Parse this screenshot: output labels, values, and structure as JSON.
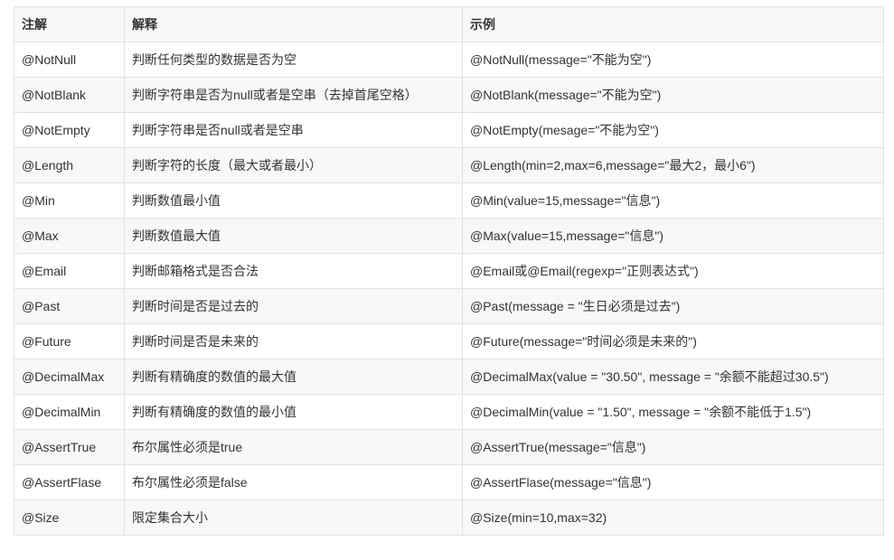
{
  "table": {
    "headers": [
      "注解",
      "解释",
      "示例"
    ],
    "rows": [
      [
        "@NotNull",
        "判断任何类型的数据是否为空",
        "@NotNull(message=\"不能为空\")"
      ],
      [
        "@NotBlank",
        "判断字符串是否为null或者是空串（去掉首尾空格）",
        "@NotBlank(message=\"不能为空\")"
      ],
      [
        "@NotEmpty",
        "判断字符串是否null或者是空串",
        "@NotEmpty(mesage=\"不能为空\")"
      ],
      [
        "@Length",
        "判断字符的长度（最大或者最小）",
        "@Length(min=2,max=6,message=\"最大2，最小6\")"
      ],
      [
        "@Min",
        "判断数值最小值",
        "@Min(value=15,message=\"信息\")"
      ],
      [
        "@Max",
        "判断数值最大值",
        "@Max(value=15,message=\"信息\")"
      ],
      [
        "@Email",
        "判断邮箱格式是否合法",
        "@Email或@Email(regexp=\"正则表达式\")"
      ],
      [
        "@Past",
        "判断时间是否是过去的",
        "@Past(message = \"生日必须是过去\")"
      ],
      [
        "@Future",
        "判断时间是否是未来的",
        "@Future(message=\"时间必须是未来的\")"
      ],
      [
        "@DecimalMax",
        "判断有精确度的数值的最大值",
        "@DecimalMax(value = \"30.50\", message = \"余额不能超过30.5\")"
      ],
      [
        "@DecimalMin",
        "判断有精确度的数值的最小值",
        "@DecimalMin(value = \"1.50\", message = \"余额不能低于1.5\")"
      ],
      [
        "@AssertTrue",
        "布尔属性必须是true",
        "@AssertTrue(message=\"信息\")"
      ],
      [
        "@AssertFlase",
        "布尔属性必须是false",
        "@AssertFlase(message=\"信息\")"
      ],
      [
        "@Size",
        "限定集合大小",
        "@Size(min=10,max=32)"
      ]
    ]
  },
  "colors": {
    "header_bg": "#f6f8fa",
    "stripe_bg": "#f8f8f8",
    "border": "#dfe2e5",
    "text": "#333333"
  }
}
